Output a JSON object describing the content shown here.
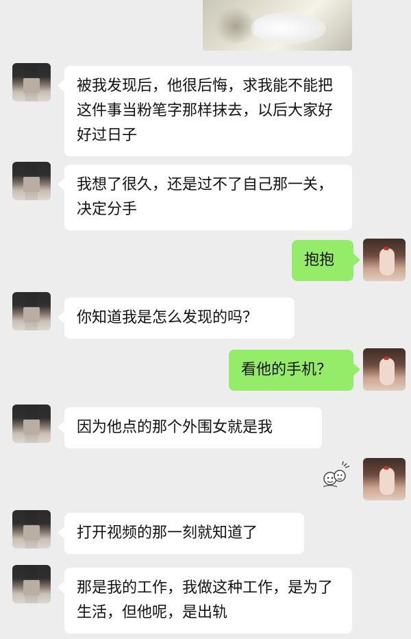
{
  "chat": {
    "messages": [
      {
        "side": "left",
        "text": "被我发现后，他很后悔，求我能不能把这件事当粉笔字那样抹去，以后大家好好过日子"
      },
      {
        "side": "left",
        "text": "我想了很久，还是过不了自己那一关，决定分手"
      },
      {
        "side": "right",
        "text": "抱抱"
      },
      {
        "side": "left",
        "text": "你知道我是怎么发现的吗？"
      },
      {
        "side": "right",
        "text": "看他的手机？"
      },
      {
        "side": "left",
        "text": "因为他点的那个外围女就是我"
      },
      {
        "side": "right",
        "sticker": "cartoon-sticker"
      },
      {
        "side": "left",
        "text": "打开视频的那一刻就知道了"
      },
      {
        "side": "left",
        "text": "那是我的工作，我做这种工作，是为了生活，但他呢，是出轨"
      }
    ]
  },
  "colors": {
    "background": "#ededed",
    "left_bubble": "#ffffff",
    "right_bubble": "#95ec69"
  }
}
